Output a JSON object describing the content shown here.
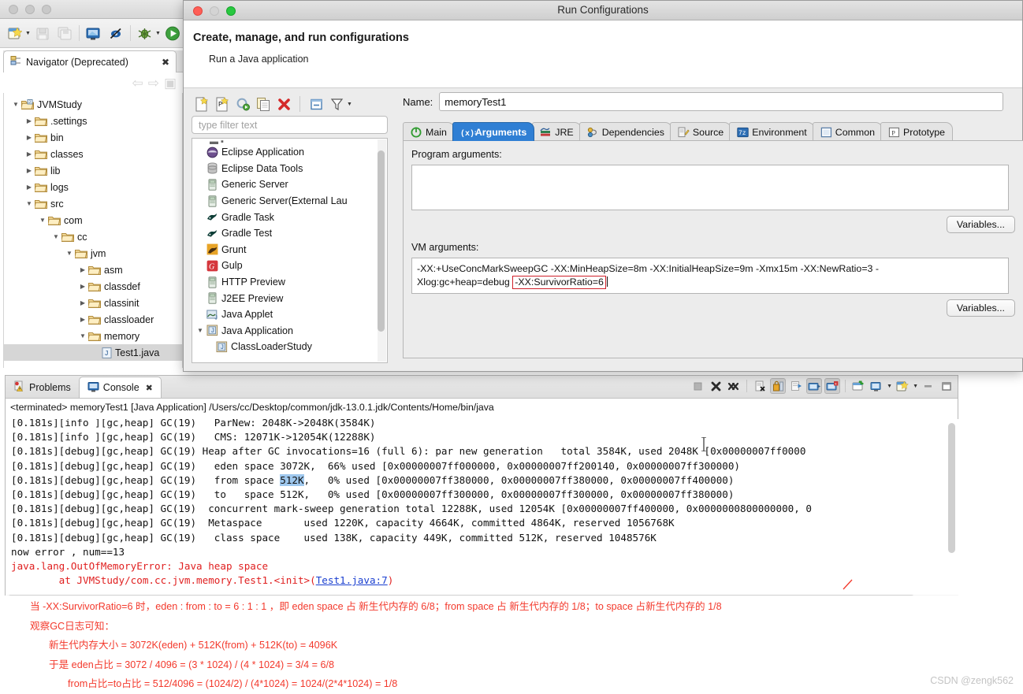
{
  "eclipse": {
    "toolbar_icons": [
      "new-wizard-icon",
      "save-icon",
      "save-all-icon",
      "open-console-icon",
      "skip-breakpoints-icon",
      "debug-icon",
      "run-icon"
    ],
    "navigator": {
      "tab_label": "Navigator (Deprecated)",
      "tab_icon": "navigator-icon",
      "close_icon": "close-icon",
      "back_icon": "back-arrow-icon",
      "forward_icon": "forward-arrow-icon",
      "collapse_icon": "collapse-all-icon",
      "tree": [
        {
          "label": "JVMStudy",
          "depth": 0,
          "twisty": "down",
          "icon": "project-folder-icon",
          "selected": false
        },
        {
          "label": ".settings",
          "depth": 1,
          "twisty": "right",
          "icon": "folder-icon",
          "selected": false
        },
        {
          "label": "bin",
          "depth": 1,
          "twisty": "right",
          "icon": "folder-icon",
          "selected": false
        },
        {
          "label": "classes",
          "depth": 1,
          "twisty": "right",
          "icon": "folder-icon",
          "selected": false
        },
        {
          "label": "lib",
          "depth": 1,
          "twisty": "right",
          "icon": "folder-icon",
          "selected": false
        },
        {
          "label": "logs",
          "depth": 1,
          "twisty": "right",
          "icon": "folder-icon",
          "selected": false
        },
        {
          "label": "src",
          "depth": 1,
          "twisty": "down",
          "icon": "folder-icon",
          "selected": false
        },
        {
          "label": "com",
          "depth": 2,
          "twisty": "down",
          "icon": "folder-icon",
          "selected": false
        },
        {
          "label": "cc",
          "depth": 3,
          "twisty": "down",
          "icon": "folder-icon",
          "selected": false
        },
        {
          "label": "jvm",
          "depth": 4,
          "twisty": "down",
          "icon": "folder-icon",
          "selected": false
        },
        {
          "label": "asm",
          "depth": 5,
          "twisty": "right",
          "icon": "folder-icon",
          "selected": false
        },
        {
          "label": "classdef",
          "depth": 5,
          "twisty": "right",
          "icon": "folder-icon",
          "selected": false
        },
        {
          "label": "classinit",
          "depth": 5,
          "twisty": "right",
          "icon": "folder-icon",
          "selected": false
        },
        {
          "label": "classloader",
          "depth": 5,
          "twisty": "right",
          "icon": "folder-icon",
          "selected": false
        },
        {
          "label": "memory",
          "depth": 5,
          "twisty": "down",
          "icon": "folder-icon",
          "selected": false
        },
        {
          "label": "Test1.java",
          "depth": 6,
          "twisty": "none",
          "icon": "java-file-icon",
          "selected": true
        }
      ]
    }
  },
  "run_config": {
    "window_title": "Run Configurations",
    "header_title": "Create, manage, and run configurations",
    "header_subtitle": "Run a Java application",
    "toolbar_icons": [
      "new-config-icon",
      "new-prototype-icon",
      "export-icon",
      "duplicate-icon",
      "delete-icon",
      "collapse-all-icon",
      "filter-icon"
    ],
    "filter_placeholder": "type filter text",
    "filter_value": "",
    "config_list": [
      {
        "label": "Eclipse Application",
        "icon": "eclipse-app-icon",
        "indent": 0,
        "twisty": "none"
      },
      {
        "label": "Eclipse Data Tools",
        "icon": "database-icon",
        "indent": 0,
        "twisty": "none"
      },
      {
        "label": "Generic Server",
        "icon": "server-icon",
        "indent": 0,
        "twisty": "none"
      },
      {
        "label": "Generic Server(External Lau",
        "icon": "server-icon",
        "indent": 0,
        "twisty": "none"
      },
      {
        "label": "Gradle Task",
        "icon": "gradle-icon",
        "indent": 0,
        "twisty": "none"
      },
      {
        "label": "Gradle Test",
        "icon": "gradle-icon",
        "indent": 0,
        "twisty": "none"
      },
      {
        "label": "Grunt",
        "icon": "grunt-icon",
        "indent": 0,
        "twisty": "none"
      },
      {
        "label": "Gulp",
        "icon": "gulp-icon",
        "indent": 0,
        "twisty": "none"
      },
      {
        "label": "HTTP Preview",
        "icon": "server-icon",
        "indent": 0,
        "twisty": "none"
      },
      {
        "label": "J2EE Preview",
        "icon": "server-icon",
        "indent": 0,
        "twisty": "none"
      },
      {
        "label": "Java Applet",
        "icon": "java-applet-icon",
        "indent": 0,
        "twisty": "none"
      },
      {
        "label": "Java Application",
        "icon": "java-application-icon",
        "indent": 0,
        "twisty": "down"
      },
      {
        "label": "ClassLoaderStudy",
        "icon": "java-application-icon",
        "indent": 1,
        "twisty": "none"
      }
    ],
    "name_label": "Name:",
    "name_value": "memoryTest1",
    "tabs": [
      {
        "label": "Main",
        "icon": "main-icon",
        "active": false
      },
      {
        "label": "Arguments",
        "icon": "arguments-icon",
        "active": true
      },
      {
        "label": "JRE",
        "icon": "jre-icon",
        "active": false
      },
      {
        "label": "Dependencies",
        "icon": "dependencies-icon",
        "active": false
      },
      {
        "label": "Source",
        "icon": "source-icon",
        "active": false
      },
      {
        "label": "Environment",
        "icon": "environment-icon",
        "active": false
      },
      {
        "label": "Common",
        "icon": "common-icon",
        "active": false
      },
      {
        "label": "Prototype",
        "icon": "prototype-icon",
        "active": false
      }
    ],
    "program_args_label": "Program arguments:",
    "program_args_value": "",
    "vm_args_label": "VM arguments:",
    "vm_args_line1": "-XX:+UseConcMarkSweepGC  -XX:MinHeapSize=8m -XX:InitialHeapSize=9m -Xmx15m -XX:NewRatio=3 -",
    "vm_args_line2_pre": "Xlog:gc+heap=debug ",
    "vm_args_highlight": "-XX:SurvivorRatio=6",
    "variables_button_1": "Variables...",
    "variables_button_2": "Variables...",
    "highlight_color": "#d0202a"
  },
  "console": {
    "tabs": [
      {
        "label": "Problems",
        "icon": "problems-icon",
        "active": false
      },
      {
        "label": "Console",
        "icon": "console-icon",
        "active": true
      }
    ],
    "close_icon": "close-icon",
    "toolbar_icons": [
      "terminate-icon",
      "remove-launch-icon",
      "remove-all-terminated-icon",
      "clear-console-icon",
      "scroll-lock-icon",
      "word-wrap-icon",
      "show-console-icon",
      "pin-console-icon",
      "display-selected-console-icon",
      "open-console-icon",
      "new-console-view-icon",
      "minimize-icon",
      "maximize-icon"
    ],
    "meta_line": "<terminated> memoryTest1 [Java Application] /Users/cc/Desktop/common/jdk-13.0.1.jdk/Contents/Home/bin/java",
    "lines": [
      {
        "text": "[0.181s][info ][gc,heap] GC(19)   ParNew: 2048K->2048K(3584K)",
        "kind": "normal",
        "clipped": true
      },
      {
        "text": "[0.181s][info ][gc,heap] GC(19)   CMS: 12071K->12054K(12288K)",
        "kind": "normal"
      },
      {
        "text": "[0.181s][debug][gc,heap] GC(19) Heap after GC invocations=16 (full 6): par new generation   total 3584K, used 2048K [0x00000007ff0000",
        "kind": "normal"
      },
      {
        "text": "[0.181s][debug][gc,heap] GC(19)   eden space 3072K,  66% used [0x00000007ff000000, 0x00000007ff200140, 0x00000007ff300000)",
        "kind": "normal"
      },
      {
        "text": "[0.181s][debug][gc,heap] GC(19)   from space ",
        "kind": "highlight",
        "hl": "512K",
        "after": ",   0% used [0x00000007ff380000, 0x00000007ff380000, 0x00000007ff400000)"
      },
      {
        "text": "[0.181s][debug][gc,heap] GC(19)   to   space 512K,   0% used [0x00000007ff300000, 0x00000007ff300000, 0x00000007ff380000)",
        "kind": "normal"
      },
      {
        "text": "[0.181s][debug][gc,heap] GC(19)  concurrent mark-sweep generation total 12288K, used 12054K [0x00000007ff400000, 0x0000000800000000, 0",
        "kind": "normal"
      },
      {
        "text": "[0.181s][debug][gc,heap] GC(19)  Metaspace       used 1220K, capacity 4664K, committed 4864K, reserved 1056768K",
        "kind": "normal"
      },
      {
        "text": "[0.181s][debug][gc,heap] GC(19)   class space    used 138K, capacity 449K, committed 512K, reserved 1048576K",
        "kind": "normal"
      },
      {
        "text": "now error , num==13",
        "kind": "normal"
      },
      {
        "text": "java.lang.OutOfMemoryError: Java heap space",
        "kind": "error"
      },
      {
        "text": "\tat JVMStudy/com.cc.jvm.memory.Test1.<init>(",
        "kind": "error-link",
        "link": "Test1.java:7",
        "after": ")"
      }
    ]
  },
  "annotation": {
    "line1": "当 -XX:SurvivorRatio=6 时，eden : from : to = 6 : 1 : 1 ，即 eden space 占 新生代内存的 6/8；from space 占 新生代内存的 1/8；to space 占新生代内存的 1/8",
    "line2": "观察GC日志可知：",
    "line3": "新生代内存大小 = 3072K(eden) + 512K(from) + 512K(to) = 4096K",
    "line4": "于是 eden占比 = 3072 / 4096 = (3 * 1024) / (4 * 1024) = 3/4 = 6/8",
    "line5": "from占比=to占比 = 512/4096 = (1024/2) / (4*1024) = 1024/(2*4*1024) = 1/8",
    "color": "#f3392c",
    "watermark": "CSDN @zengk562"
  }
}
